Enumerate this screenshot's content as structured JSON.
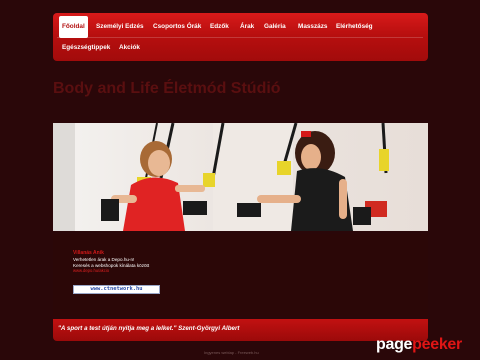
{
  "nav": {
    "items": [
      {
        "label": "Főoldal",
        "active": true
      },
      {
        "label": "Személyi Edzés"
      },
      {
        "label": "Csoportos Órák"
      },
      {
        "label": "Edzők"
      },
      {
        "label": "Árak"
      },
      {
        "label": "Galéria"
      },
      {
        "label": "Masszázs"
      },
      {
        "label": "Elérhetőség"
      },
      {
        "label": "Egészségtippek"
      },
      {
        "label": "Akciók"
      }
    ]
  },
  "site_title": "Body and Life Életmód Stúdió",
  "promo": {
    "title": "Villanás Anik",
    "line1": "Verhetetlen árak a Depo.hu-n!",
    "line2": "Keresés a webshopok kínálata között",
    "link": "www.depo.hu/akcio"
  },
  "banner": {
    "text": "www.ctnetwork.hu"
  },
  "quote": "\"A sport a test útján nyitja meg a lelket.\" Szent-Györgyi Albert",
  "footer": "Ingyenes weblap - Freeweb.hu",
  "watermark": {
    "part1": "page",
    "part2": "peeker"
  },
  "colors": {
    "accent": "#c81414",
    "background": "#2a0709",
    "title": "#5a0f10"
  }
}
